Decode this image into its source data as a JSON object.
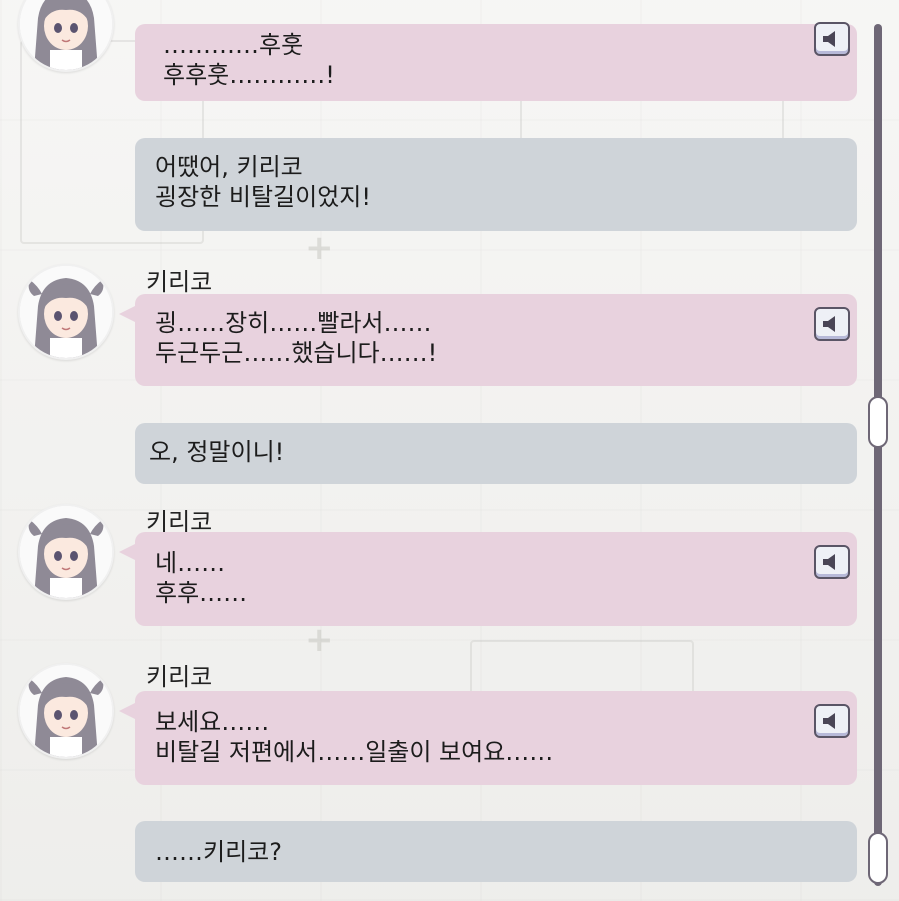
{
  "entries": [
    {
      "speaker": "",
      "type": "pink",
      "lines": [
        "…………후훗",
        "후후훗…………!"
      ],
      "voice_icon": "speaker-icon",
      "has_avatar": true
    },
    {
      "speaker": "",
      "type": "gray",
      "lines": [
        "어땠어, 키리코",
        "굉장한 비탈길이었지!"
      ]
    },
    {
      "speaker": "키리코",
      "type": "pink",
      "lines": [
        "굉……장히……빨라서……",
        "두근두근……했습니다……!"
      ],
      "voice_icon": "speaker-icon"
    },
    {
      "speaker": "",
      "type": "gray",
      "lines": [
        "오, 정말이니!"
      ]
    },
    {
      "speaker": "키리코",
      "type": "pink",
      "lines": [
        "네……",
        "후후……"
      ],
      "voice_icon": "speaker-icon"
    },
    {
      "speaker": "키리코",
      "type": "pink",
      "lines": [
        "보세요……",
        "비탈길 저편에서……일출이 보여요……"
      ],
      "voice_icon": "speaker-icon"
    },
    {
      "speaker": "",
      "type": "gray",
      "lines": [
        "……키리코?"
      ]
    }
  ],
  "colors": {
    "pink_bubble": "#e8d2de",
    "gray_bubble": "#cfd4d9",
    "scrollbar": "#6e6776"
  },
  "scroll": {
    "position": 0.48
  }
}
